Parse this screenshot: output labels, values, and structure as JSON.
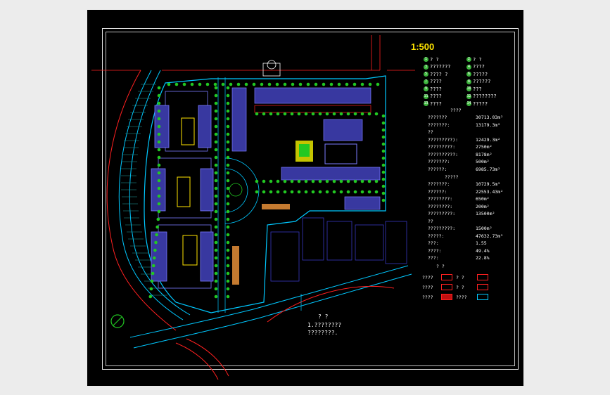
{
  "drawing": {
    "scale_label": "1:500",
    "north_symbol": "north-arrow"
  },
  "legend": {
    "items": [
      {
        "num": "1",
        "label": "? ?"
      },
      {
        "num": "2",
        "label": "? ?"
      },
      {
        "num": "3",
        "label": "???????"
      },
      {
        "num": "4",
        "label": "????"
      },
      {
        "num": "5",
        "label": "???? ?"
      },
      {
        "num": "6",
        "label": "?????"
      },
      {
        "num": "7",
        "label": "????"
      },
      {
        "num": "8",
        "label": "??????"
      },
      {
        "num": "9",
        "label": "????"
      },
      {
        "num": "10",
        "label": "???"
      },
      {
        "num": "11",
        "label": "????"
      },
      {
        "num": "12",
        "label": "????????"
      },
      {
        "num": "13",
        "label": "????"
      },
      {
        "num": "14",
        "label": "?????"
      }
    ]
  },
  "stats": {
    "heading1": "????",
    "group1": [
      {
        "label": "???????",
        "value": "30713.03m²"
      },
      {
        "label": "???????:",
        "value": "13179.3m²"
      },
      {
        "label": "??",
        "value": ""
      },
      {
        "label": "?????????):",
        "value": "12429.3m²"
      },
      {
        "label": "?????????:",
        "value": "2750m²"
      },
      {
        "label": "??????????:",
        "value": "8178m²"
      },
      {
        "label": "???????:",
        "value": "500m²"
      },
      {
        "label": "??????:",
        "value": "6985.73m²"
      }
    ],
    "heading2": "?????",
    "group2": [
      {
        "label": "???????:",
        "value": "10729.5m²"
      },
      {
        "label": "??????:",
        "value": "22553.43m²"
      },
      {
        "label": "????????:",
        "value": "650m²"
      },
      {
        "label": "????????:",
        "value": "200m²"
      },
      {
        "label": "?????????:",
        "value": "13500m²"
      },
      {
        "label": "??",
        "value": ""
      },
      {
        "label": "?????????:",
        "value": "1500m²"
      },
      {
        "label": "?????:",
        "value": "47632.73m²"
      },
      {
        "label": "???:",
        "value": "1.55"
      },
      {
        "label": "????:",
        "value": "49.4%"
      },
      {
        "label": "???:",
        "value": "22.8%"
      }
    ],
    "heading3": "?   ?"
  },
  "symbols": [
    {
      "label": "????",
      "mid": "?  ?",
      "right": ""
    },
    {
      "label": "????",
      "mid": "?  ?",
      "right": ""
    },
    {
      "label": "????",
      "mid": "????",
      "right": ""
    }
  ],
  "bottom_note": {
    "line1": "?   ?",
    "line2": "1.????????",
    "line3": "????????."
  },
  "colors": {
    "background": "#000000",
    "building": "#7b7bff",
    "road": "#00c8ff",
    "boundary": "#ff2020",
    "tree": "#22c822",
    "accent": "#ffe400"
  }
}
